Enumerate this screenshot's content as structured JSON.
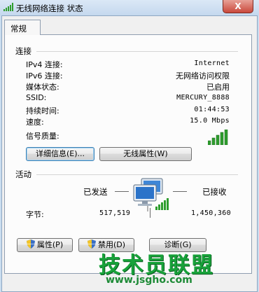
{
  "window": {
    "title": "无线网络连接 状态",
    "close_glyph": "X"
  },
  "tabs": [
    {
      "label": "常规"
    }
  ],
  "connection": {
    "heading": "连接",
    "rows": [
      {
        "label": "IPv4 连接:",
        "value": "Internet"
      },
      {
        "label": "IPv6 连接:",
        "value": "无网络访问权限"
      },
      {
        "label": "媒体状态:",
        "value": "已启用"
      },
      {
        "label": "SSID:",
        "value": "MERCURY_8888"
      },
      {
        "label": "持续时间:",
        "value": "01:44:53"
      },
      {
        "label": "速度:",
        "value": "15.0 Mbps"
      }
    ],
    "signal_label": "信号质量:",
    "signal_bars": 5,
    "details_button": "详细信息(E)...",
    "wireless_props_button": "无线属性(W)"
  },
  "activity": {
    "heading": "活动",
    "sent_label": "已发送",
    "received_label": "已接收",
    "bytes_label": "字节:",
    "bytes_sent": "517,519",
    "bytes_received": "1,450,360"
  },
  "bottom_buttons": {
    "properties": "属性(P)",
    "disable": "禁用(D)",
    "diagnose": "诊断(G)"
  },
  "watermark": {
    "main": "技术员联盟",
    "sub": "www.jsgho.com"
  },
  "colors": {
    "signal_green": "#2e9d2e",
    "window_frame": "#c9dcef",
    "watermark_green": "#18a23a"
  }
}
